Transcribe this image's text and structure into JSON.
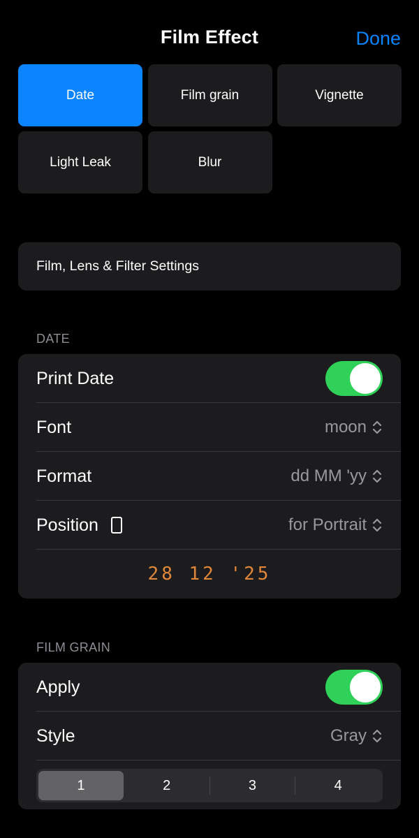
{
  "header": {
    "title": "Film Effect",
    "done_label": "Done"
  },
  "effects": [
    {
      "label": "Date",
      "selected": true
    },
    {
      "label": "Film grain",
      "selected": false
    },
    {
      "label": "Vignette",
      "selected": false
    },
    {
      "label": "Light Leak",
      "selected": false
    },
    {
      "label": "Blur",
      "selected": false
    }
  ],
  "settings_link": {
    "label": "Film, Lens & Filter Settings"
  },
  "date_section": {
    "header": "DATE",
    "print_date": {
      "label": "Print Date",
      "on": true
    },
    "font": {
      "label": "Font",
      "value": "moon"
    },
    "format": {
      "label": "Format",
      "value": "dd MM 'yy"
    },
    "position": {
      "label": "Position",
      "value": "for Portrait"
    },
    "preview": "28 12 '25"
  },
  "film_grain_section": {
    "header": "FILM GRAIN",
    "apply": {
      "label": "Apply",
      "on": true
    },
    "style": {
      "label": "Style",
      "value": "Gray"
    },
    "intensity": {
      "options": [
        "1",
        "2",
        "3",
        "4"
      ],
      "selected": "1"
    }
  },
  "colors": {
    "accent": "#0a84ff",
    "toggle_on": "#30d158",
    "date_preview": "#e0873a",
    "card_bg": "#1c1c1e"
  },
  "icons": [
    "chevron-up-down-icon",
    "portrait-orientation-icon"
  ]
}
